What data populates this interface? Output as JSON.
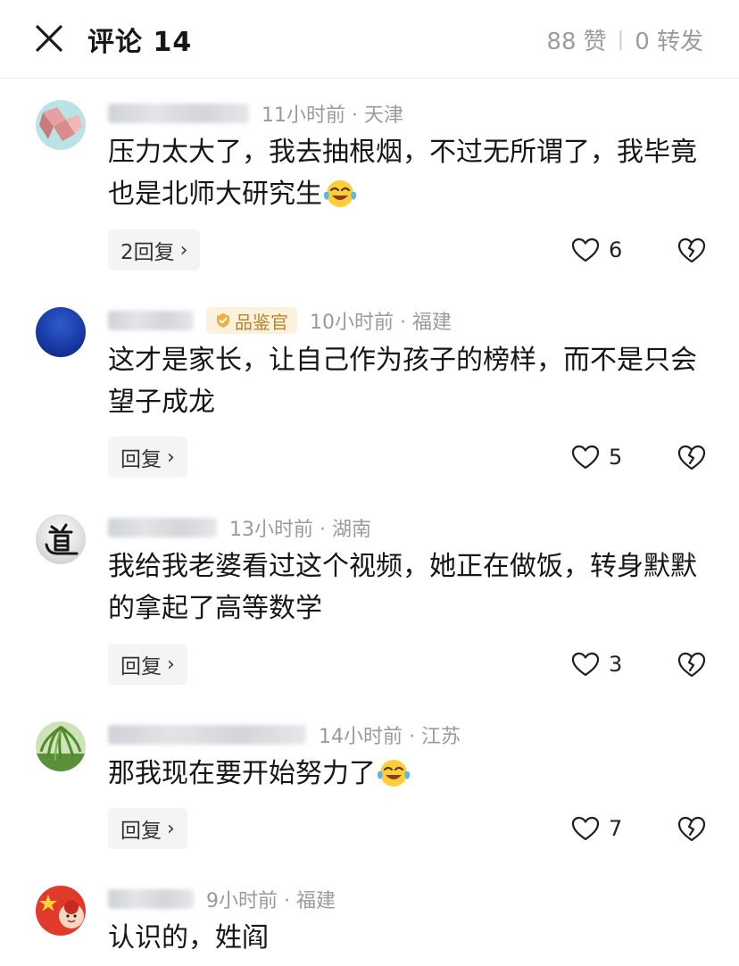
{
  "header": {
    "title": "评论 14",
    "likes": "88 赞",
    "separator": "|",
    "shares": "0 转发"
  },
  "comments": [
    {
      "time_location": "11小时前 · 天津",
      "text": "压力太大了，我去抽根烟，不过无所谓了，我毕竟也是北师大研究生",
      "reply_label": "2回复",
      "likes": "6"
    },
    {
      "badge": "品鉴官",
      "time_location": "10小时前 · 福建",
      "text": "这才是家长，让自己作为孩子的榜样，而不是只会望子成龙",
      "reply_label": "回复",
      "likes": "5"
    },
    {
      "time_location": "13小时前 · 湖南",
      "text": "我给我老婆看过这个视频，她正在做饭，转身默默的拿起了高等数学",
      "reply_label": "回复",
      "likes": "3"
    },
    {
      "time_location": "14小时前 · 江苏",
      "text": "那我现在要开始努力了",
      "reply_label": "回复",
      "likes": "7"
    },
    {
      "time_location": "9小时前 · 福建",
      "text": "认识的，姓阎"
    }
  ],
  "icons": {
    "close": "close-icon",
    "heart": "heart-icon",
    "broken_heart": "broken-heart-icon",
    "emoji": "laugh-cry-emoji"
  }
}
